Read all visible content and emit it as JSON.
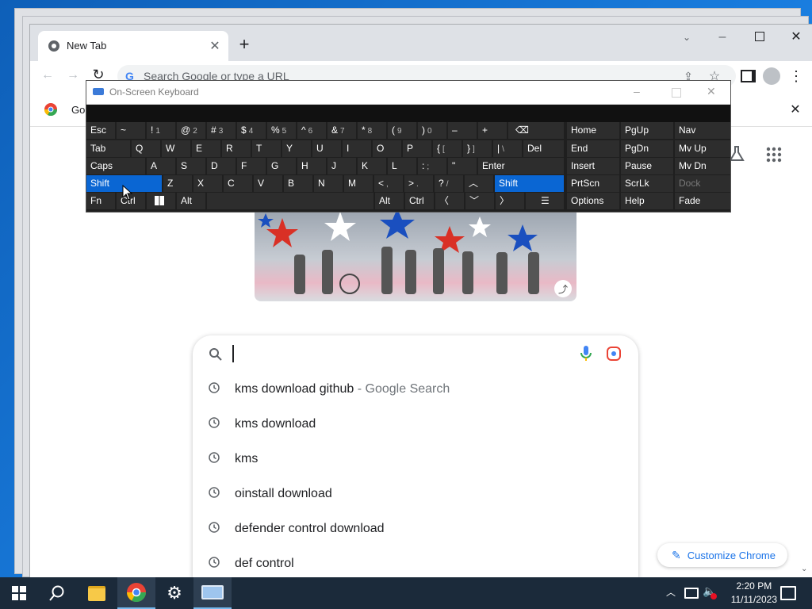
{
  "browser": {
    "tab_title": "New Tab",
    "omnibox_placeholder": "Search Google or type a URL",
    "bookmark_label": "Go"
  },
  "osk": {
    "title": "On-Screen Keyboard",
    "keys": {
      "esc": "Esc",
      "tilde": "~",
      "n1": "!",
      "n1s": "1",
      "n2": "@",
      "n2s": "2",
      "n3": "#",
      "n3s": "3",
      "n4": "$",
      "n4s": "4",
      "n5": "%",
      "n5s": "5",
      "n6": "^",
      "n6s": "6",
      "n7": "&",
      "n7s": "7",
      "n8": "*",
      "n8s": "8",
      "n9": "(",
      "n9s": "9",
      "n0": ")",
      "n0s": "0",
      "minus": "–",
      "plus": "+",
      "tab": "Tab",
      "q": "Q",
      "w": "W",
      "e": "E",
      "r": "R",
      "t": "T",
      "y": "Y",
      "u": "U",
      "i": "I",
      "o": "O",
      "p": "P",
      "lbrace": "{",
      "lbrack": "[",
      "rbrace": "}",
      "rbrack": "]",
      "pipe": "|",
      "bslash": "\\",
      "del": "Del",
      "caps": "Caps",
      "a": "A",
      "s": "S",
      "d": "D",
      "f": "F",
      "g": "G",
      "h": "H",
      "j": "J",
      "k": "K",
      "l": "L",
      "colon": ":",
      "semi": ";",
      "quote": "\"",
      "enter": "Enter",
      "shift": "Shift",
      "z": "Z",
      "x": "X",
      "c": "C",
      "v": "V",
      "b": "B",
      "n": "N",
      "m": "M",
      "lt": "<",
      "comma": ",",
      "gt": ">",
      "period": ".",
      "question": "?",
      "slash": "/",
      "fn": "Fn",
      "ctrl": "Ctrl",
      "alt": "Alt",
      "home": "Home",
      "pgup": "PgUp",
      "nav": "Nav",
      "end": "End",
      "pgdn": "PgDn",
      "mvup": "Mv Up",
      "insert": "Insert",
      "pause": "Pause",
      "mvdn": "Mv Dn",
      "prtscn": "PrtScn",
      "scrlk": "ScrLk",
      "dock": "Dock",
      "options": "Options",
      "help": "Help",
      "fade": "Fade"
    }
  },
  "suggestions": [
    {
      "text": "kms download github",
      "suffix": " - Google Search"
    },
    {
      "text": "kms download",
      "suffix": ""
    },
    {
      "text": "kms",
      "suffix": ""
    },
    {
      "text": "oinstall download",
      "suffix": ""
    },
    {
      "text": "defender control download",
      "suffix": ""
    },
    {
      "text": "def control",
      "suffix": ""
    }
  ],
  "customize_label": "Customize Chrome",
  "taskbar": {
    "time": "2:20 PM",
    "date": "11/11/2023"
  },
  "colors": {
    "osk_highlight": "#0a66d3",
    "taskbar": "#1b2a3a",
    "google_blue": "#4285f4"
  }
}
